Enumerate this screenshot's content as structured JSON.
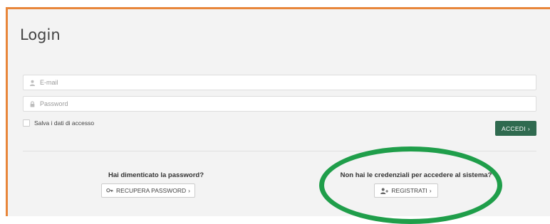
{
  "login": {
    "title": "Login",
    "email_placeholder": "E-mail",
    "password_placeholder": "Password",
    "remember_label": "Salva i dati di accesso",
    "submit_label": "ACCEDI",
    "submit_chevron": "›"
  },
  "recover": {
    "heading": "Hai dimenticato la password?",
    "button_label": "RECUPERA PASSWORD",
    "button_icon": "key-icon",
    "chevron": "›"
  },
  "register": {
    "heading": "Non hai le credenziali per accedere al sistema?",
    "button_label": "REGISTRATI",
    "button_icon": "add-user-icon",
    "chevron": "›"
  },
  "colors": {
    "accent_border": "#e8863a",
    "primary_button": "#2f6a4f",
    "annotation": "#1f9e4a"
  }
}
